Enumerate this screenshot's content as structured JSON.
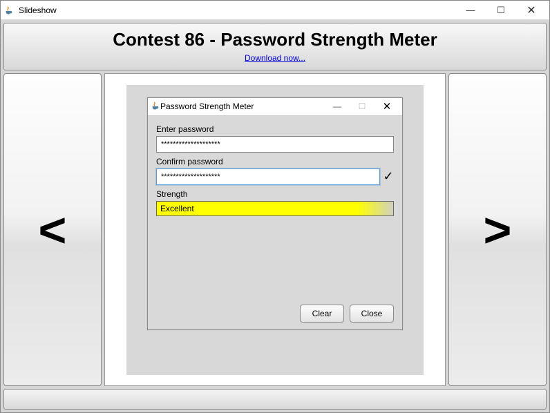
{
  "outer": {
    "title": "Slideshow",
    "controls": {
      "min": "—",
      "max": "☐",
      "close": "✕"
    }
  },
  "header": {
    "title": "Contest 86 - Password Strength Meter",
    "download_label": "Download now..."
  },
  "nav": {
    "prev_symbol": "<",
    "next_symbol": ">"
  },
  "inner": {
    "title": "Password Strength Meter",
    "controls": {
      "min": "—",
      "max": "☐",
      "close": "✕"
    },
    "enter_label": "Enter password",
    "enter_value": "********************",
    "confirm_label": "Confirm password",
    "confirm_value": "********************",
    "checkmark": "✓",
    "strength_label": "Strength",
    "strength_value": "Excellent",
    "clear_label": "Clear",
    "close_label": "Close"
  }
}
